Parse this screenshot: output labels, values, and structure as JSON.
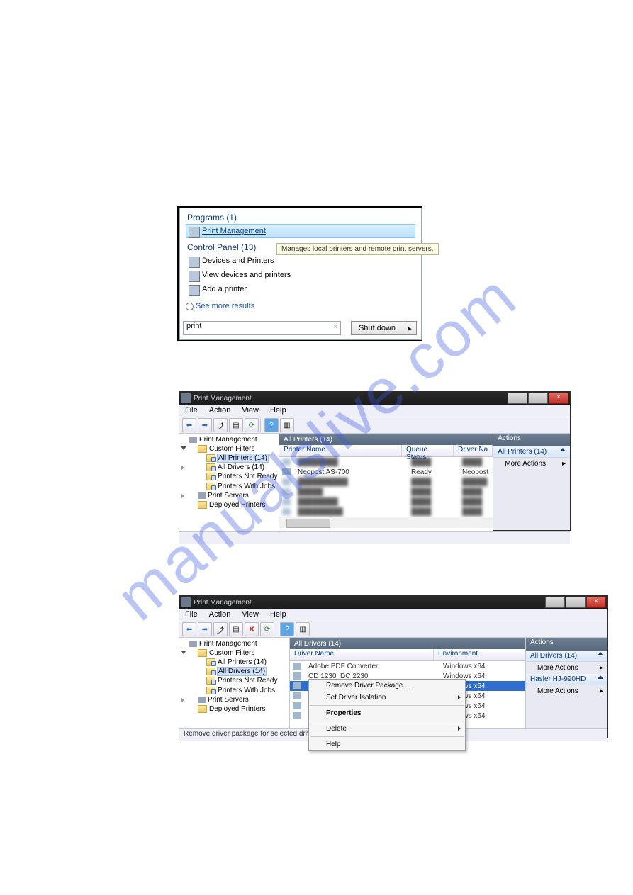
{
  "watermark": "manualslive.com",
  "start_menu": {
    "programs_header": "Programs (1)",
    "program_item": "Print Management",
    "tooltip": "Manages local printers and remote print servers.",
    "cp_header": "Control Panel (13)",
    "cp_items": [
      "Devices and Printers",
      "View devices and printers",
      "Add a printer"
    ],
    "more_results": "See more results",
    "search_value": "print",
    "shutdown_label": "Shut down"
  },
  "mmc1": {
    "title": "Print Management",
    "menus": [
      "File",
      "Action",
      "View",
      "Help"
    ],
    "tree": {
      "root": "Print Management",
      "custom_filters": "Custom Filters",
      "filters": [
        "All Printers (14)",
        "All Drivers (14)",
        "Printers Not Ready",
        "Printers With Jobs"
      ],
      "selected_index": 0,
      "print_servers": "Print Servers",
      "deployed": "Deployed Printers"
    },
    "main_header": "All Printers (14)",
    "columns": {
      "c1": "Printer Name",
      "c2": "Queue Status",
      "c3": "Driver Na"
    },
    "visible_row": {
      "name": "Neopost AS-700",
      "status": "Ready",
      "driver": "Neopost"
    },
    "actions": {
      "header": "Actions",
      "cat": "All Printers (14)",
      "item": "More Actions"
    }
  },
  "mmc2": {
    "title": "Print Management",
    "menus": [
      "File",
      "Action",
      "View",
      "Help"
    ],
    "tree": {
      "root": "Print Management",
      "custom_filters": "Custom Filters",
      "filters": [
        "All Printers (14)",
        "All Drivers (14)",
        "Printers Not Ready",
        "Printers With Jobs"
      ],
      "selected_index": 1,
      "print_servers": "Print Servers",
      "deployed": "Deployed Printers"
    },
    "main_header": "All Drivers (14)",
    "columns": {
      "c1": "Driver Name",
      "c2": "Environment"
    },
    "rows": [
      {
        "name": "Adobe PDF Converter",
        "env": "Windows x64"
      },
      {
        "name": "CD 1230_DC 2230",
        "env": "Windows x64"
      },
      {
        "name": "",
        "env": "Windows x64",
        "selected": true
      },
      {
        "name": "",
        "env": "Windows x64"
      },
      {
        "name": "",
        "env": "Windows x64"
      },
      {
        "name": "",
        "env": "Windows x64"
      }
    ],
    "context_menu": [
      "Remove Driver Package…",
      "Set Driver Isolation",
      "Properties",
      "Delete",
      "Help"
    ],
    "status_text": "Remove driver package for selected driver.",
    "actions": {
      "header": "Actions",
      "cat1": "All Drivers (14)",
      "item1": "More Actions",
      "cat2": "Hasler HJ-990HD",
      "item2": "More Actions"
    }
  }
}
